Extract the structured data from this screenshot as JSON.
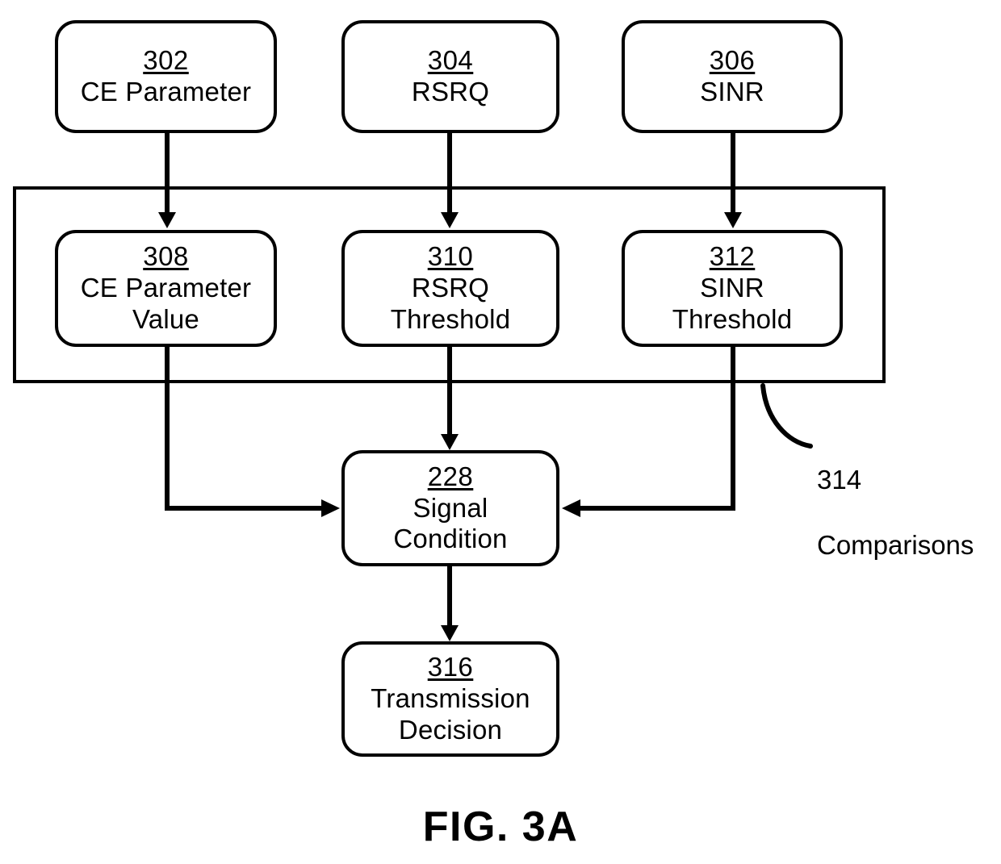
{
  "figure": {
    "caption": "FIG. 3A",
    "type": "patent-flow-diagram"
  },
  "nodes": {
    "ce_parameter": {
      "ref": "302",
      "label": "CE Parameter"
    },
    "rsrq": {
      "ref": "304",
      "label": "RSRQ"
    },
    "sinr": {
      "ref": "306",
      "label": "SINR"
    },
    "ce_parameter_value": {
      "ref": "308",
      "label": "CE Parameter\nValue"
    },
    "rsrq_threshold": {
      "ref": "310",
      "label": "RSRQ\nThreshold"
    },
    "sinr_threshold": {
      "ref": "312",
      "label": "SINR\nThreshold"
    },
    "signal_condition": {
      "ref": "228",
      "label": "Signal\nCondition"
    },
    "transmission_decision": {
      "ref": "316",
      "label": "Transmission\nDecision"
    }
  },
  "groups": {
    "comparisons": {
      "ref": "314",
      "label": "Comparisons"
    }
  },
  "style": {
    "stroke": "#000000",
    "background": "#ffffff"
  }
}
